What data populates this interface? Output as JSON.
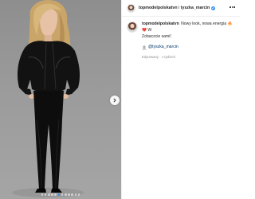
{
  "post": {
    "author": "topmodelpolskatvn",
    "separator": "i",
    "collaborator": "tyszka_marcin"
  },
  "caption": {
    "username": "topmodelpolskatvn",
    "text": "Nowy look, nowa energia",
    "emojis": "🔥❤️",
    "text_end": "W",
    "line2": "Zobaczcie sami!",
    "tag_prefix": "@",
    "tag_user": "tyszka_marcin",
    "time": "Edytowany · 1 tydzień"
  },
  "carousel": {
    "slide_count": 12,
    "active_index": 5
  },
  "icons": {
    "verified": "verified-badge-icon",
    "more": "more-options-icon",
    "next": "chevron-right-icon",
    "tag": "tag-person-icon"
  },
  "colors": {
    "accent": "#3897f0",
    "link": "#00376b",
    "backdrop": "#9b9b9b"
  }
}
